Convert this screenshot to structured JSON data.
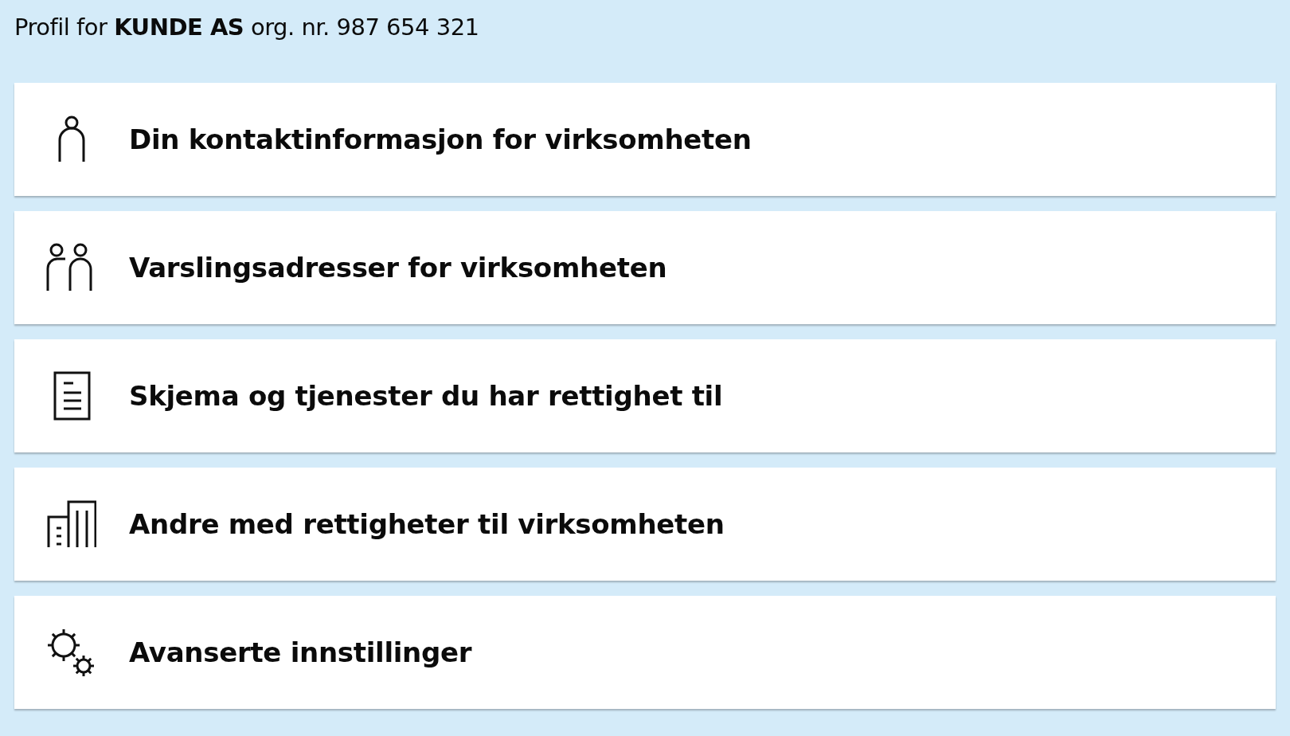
{
  "header": {
    "text": "Profil for **KUNDE AS** org. nr. 987 654 321"
  },
  "menu": [
    {
      "kind": "person",
      "label": "Din kontaktinformasjon for virksomheten"
    },
    {
      "kind": "people",
      "label": "Varslingsadresser for virksomheten"
    },
    {
      "kind": "document",
      "label": "Skjema og tjenester du har rettighet til"
    },
    {
      "kind": "building",
      "label": "Andre med rettigheter til virksomheten"
    },
    {
      "kind": "gears",
      "label": "Avanserte innstillinger"
    }
  ]
}
